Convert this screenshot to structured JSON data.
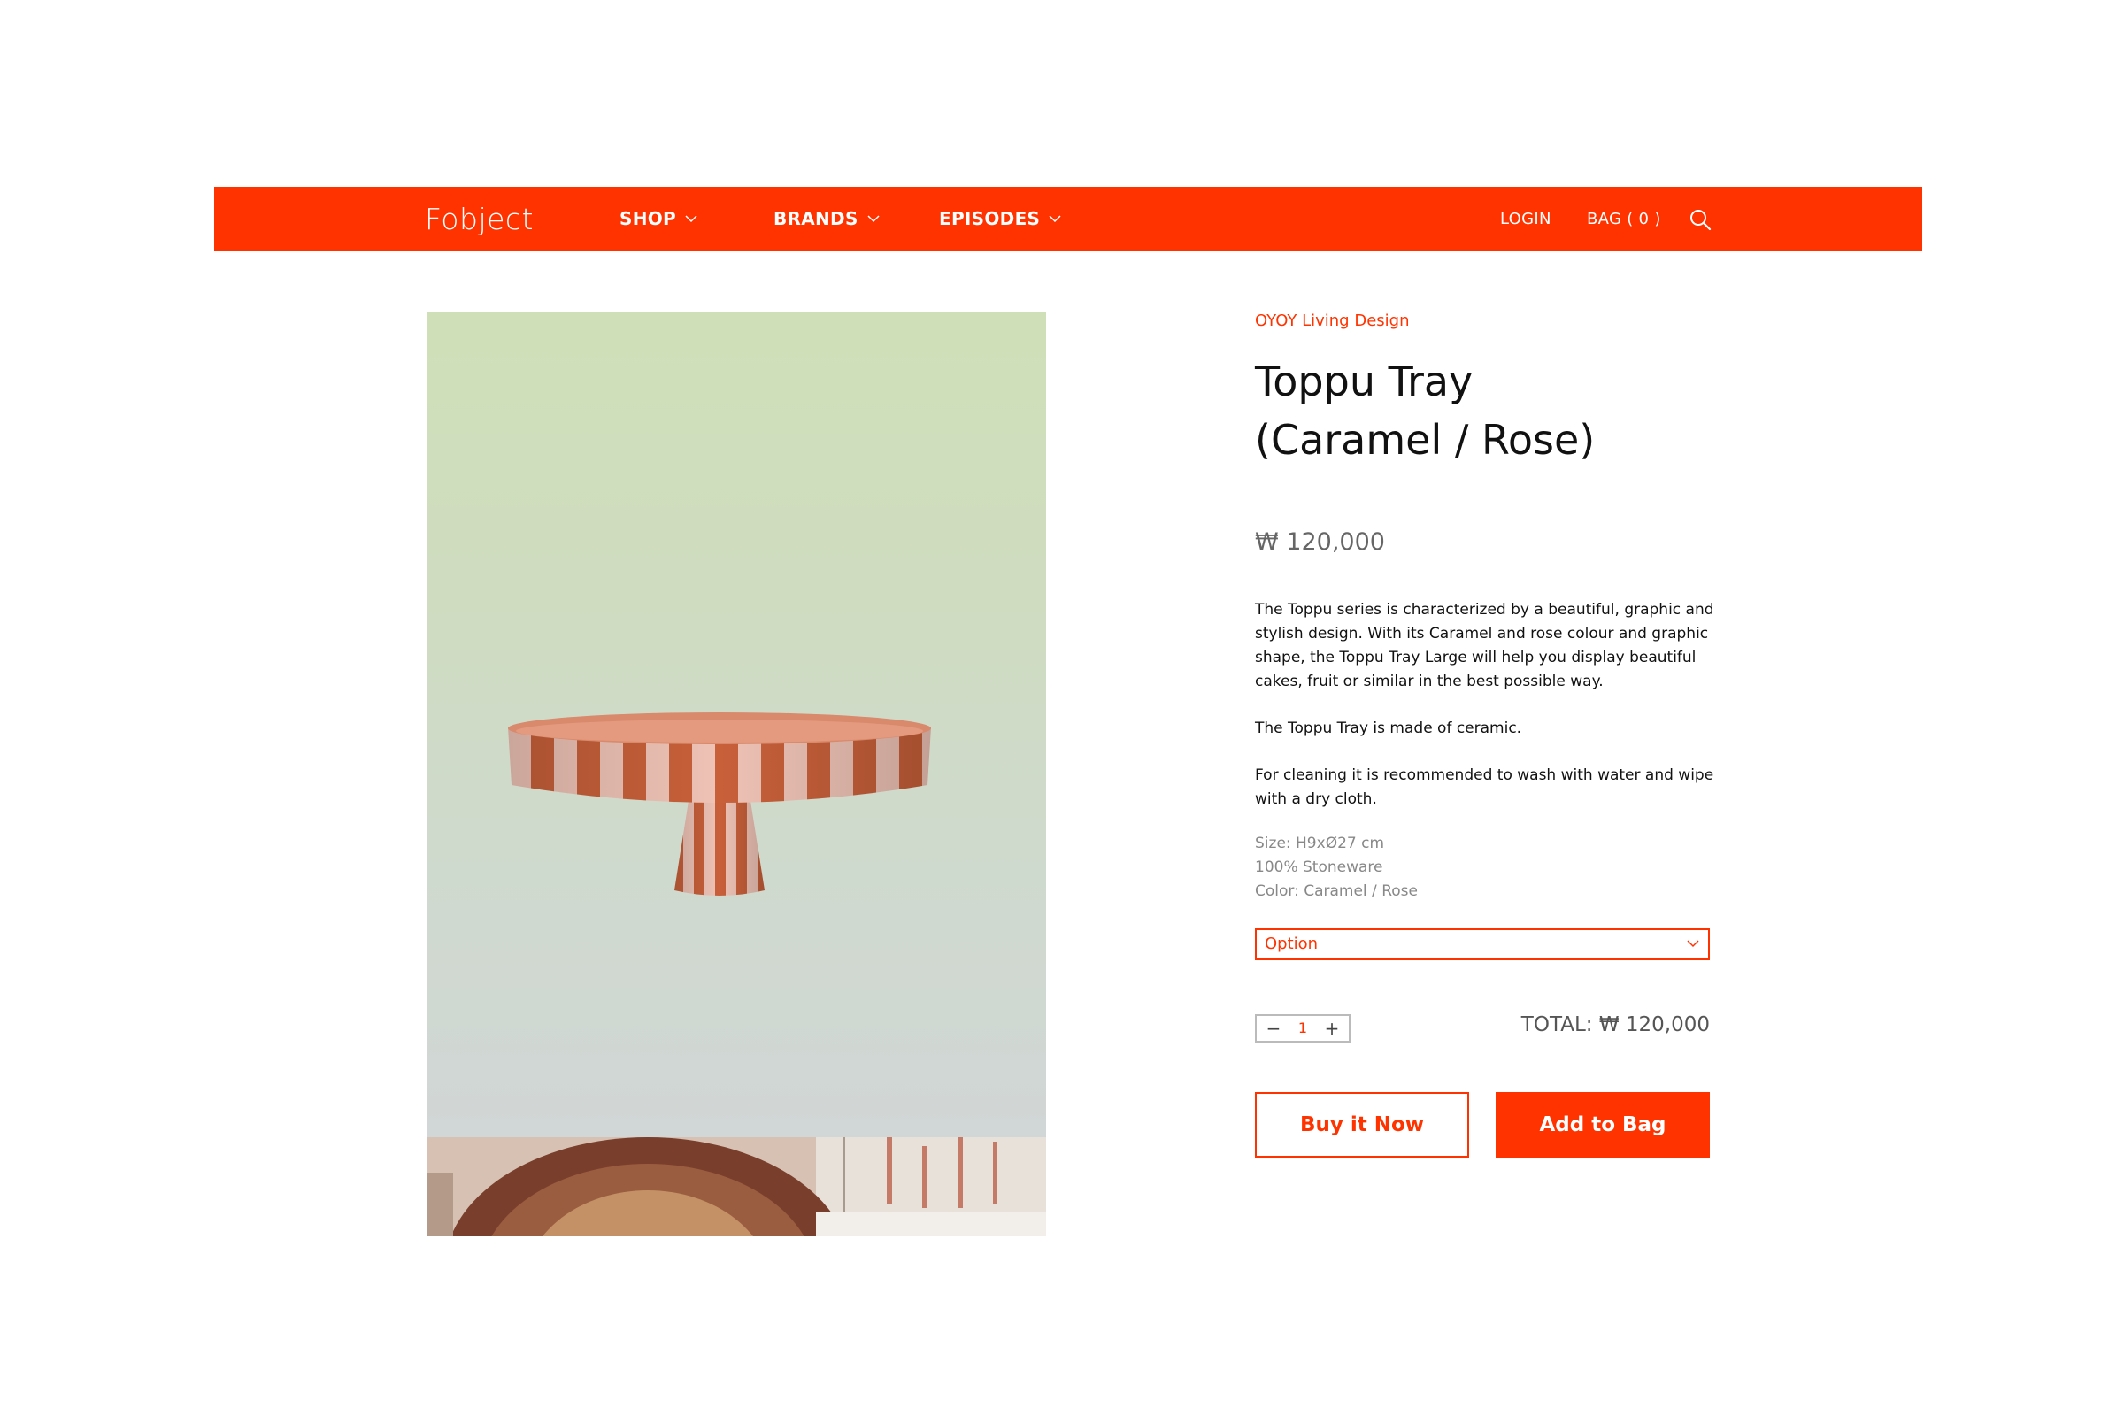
{
  "header": {
    "logo": "Fobject",
    "nav": {
      "shop": "SHOP",
      "brands": "BRANDS",
      "episodes": "EPISODES",
      "login": "LOGIN",
      "bag": "BAG ( 0 )"
    },
    "icons": {
      "search": "search-icon",
      "dropdown": "chevron-down-icon"
    }
  },
  "product": {
    "brand": "OYOY Living Design",
    "title_line1": "Toppu Tray",
    "title_line2": "(Caramel / Rose)",
    "price": "₩ 120,000",
    "description": [
      "The Toppu series is characterized by a beautiful, graphic and stylish design. With its Caramel and rose colour and graphic shape, the Toppu Tray Large will help you display beautiful cakes, fruit or similar in the best possible way.",
      "The Toppu Tray is made of ceramic.",
      "For cleaning it is recommended to wash with water and wipe with a dry cloth."
    ],
    "specs": [
      "Size: H9xØ27 cm",
      "100% Stoneware",
      "Color: Caramel / Rose"
    ],
    "option_label": "Option",
    "quantity": "1",
    "qty_minus": "−",
    "qty_plus": "+",
    "total": "TOTAL: ₩ 120,000",
    "buy_now": "Buy it Now",
    "add_to_bag": "Add to Bag"
  },
  "colors": {
    "accent": "#ff3300",
    "caramel": "#c8603a",
    "rose": "#efc3b6",
    "image_top": "#cfe0b8",
    "image_bottom": "#d1d6d6"
  }
}
